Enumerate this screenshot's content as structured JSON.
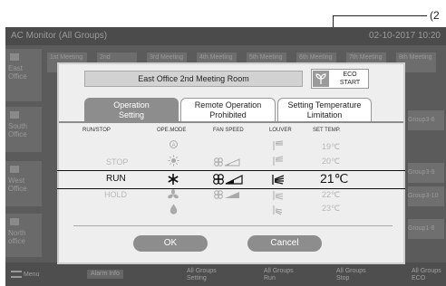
{
  "callout": {
    "label": "(2"
  },
  "background": {
    "title": "AC Monitor (All Groups)",
    "datetime": "02-10-2017  10:20",
    "groups": [
      "East\nOffice",
      "South\nOffice",
      "West\nOffice",
      "North\noffice"
    ],
    "tabs": [
      "1st Meeting",
      "2nd Meeting",
      "3rd Meeting",
      "4th Meeting",
      "5th Meeting",
      "6th Meeting",
      "7th Meeting",
      "8th Meeting"
    ],
    "cells": [
      "Group3-8",
      "Group3-9",
      "Group3-10",
      "Group1-8"
    ],
    "bottom": [
      "Menu",
      "Alarm Info",
      "All Groups\nSetting",
      "All Groups\nRun",
      "All Groups\nStop",
      "All Groups\nECO"
    ]
  },
  "dialog": {
    "room_name": "East Office 2nd Meeting Room",
    "eco_label_1": "ECO",
    "eco_label_2": "START",
    "tabs": [
      {
        "label": "Operation\nSetting",
        "active": true
      },
      {
        "label": "Remote Operation\nProhibited",
        "active": false
      },
      {
        "label": "Setting Temperature\nLimitation",
        "active": false
      }
    ],
    "headers": {
      "runstop": "RUN/STOP",
      "opemode": "OPE.MODE",
      "fanspeed": "FAN SPEED",
      "louver": "LOUVER",
      "settemp": "SET TEMP."
    },
    "rows": [
      {
        "runstop": "",
        "mode": "auto-icon",
        "temp": "19℃"
      },
      {
        "runstop": "STOP",
        "mode": "heat-icon",
        "temp": "20℃"
      },
      {
        "runstop": "RUN",
        "mode": "cool-icon",
        "temp": "21℃"
      },
      {
        "runstop": "HOLD",
        "mode": "fan-icon",
        "temp": "22℃"
      },
      {
        "runstop": "",
        "mode": "dry-icon",
        "temp": "23℃"
      }
    ],
    "ok_label": "OK",
    "cancel_label": "Cancel"
  }
}
